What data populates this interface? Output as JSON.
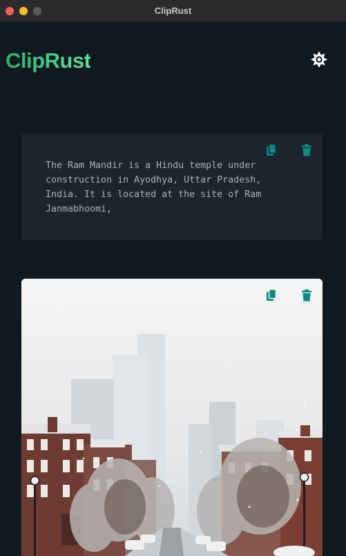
{
  "window": {
    "title": "ClipRust"
  },
  "header": {
    "logo": "ClipRust",
    "theme_icon": "sun-icon"
  },
  "colors": {
    "accent": "#0a8a80",
    "logo": "#3cc47c",
    "background": "#101820",
    "card": "#1b252e"
  },
  "clips": [
    {
      "type": "text",
      "content": "The Ram Mandir is a Hindu temple under\nconstruction in Ayodhya, Uttar Pradesh,\nIndia. It is located at the site of Ram\nJanmabhoomi,",
      "actions": [
        "copy-icon",
        "trash-icon"
      ]
    },
    {
      "type": "image",
      "actions": [
        "copy-icon",
        "trash-icon"
      ]
    }
  ]
}
